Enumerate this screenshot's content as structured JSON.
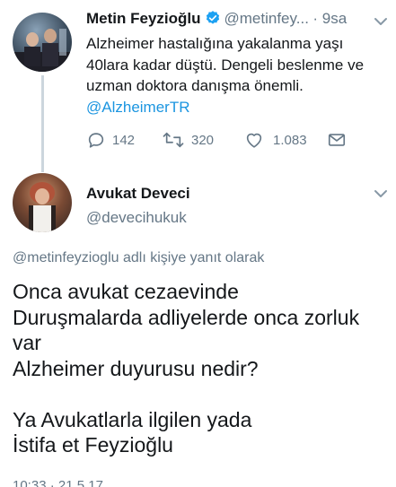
{
  "tweet1": {
    "name": "Metin Feyzioğlu",
    "handle": "@metinfey...",
    "time": "· 9sa",
    "text": "Alzheimer hastalığına yakalanma yaşı 40lara kadar düştü. Dengeli beslenme ve uzman doktora danışma önemli.",
    "mention": "@AlzheimerTR",
    "replies": "142",
    "retweets": "320",
    "likes": "1.083",
    "icons": [
      "verified-badge-icon",
      "reply-icon",
      "retweet-icon",
      "like-icon",
      "dm-icon",
      "chevron-down-icon"
    ]
  },
  "tweet2": {
    "name": "Avukat Deveci",
    "handle": "@devecihukuk",
    "reply_to": "@metinfeyzioglu adlı kişiye yanıt olarak",
    "text": "Onca avukat cezaevinde\nDuruşmalarda adliyelerde onca zorluk var\nAlzheimer duyurusu nedir?\n\nYa Avukatlarla ilgilen yada\nİstifa et Feyzioğlu",
    "timestamp": "10:33 · 21.5.17",
    "icons": [
      "chevron-down-icon"
    ]
  },
  "colors": {
    "text": "#14171a",
    "muted": "#657786",
    "link": "#1b95e0",
    "verified": "#1da1f2",
    "thread_line": "#ccd6dd"
  }
}
